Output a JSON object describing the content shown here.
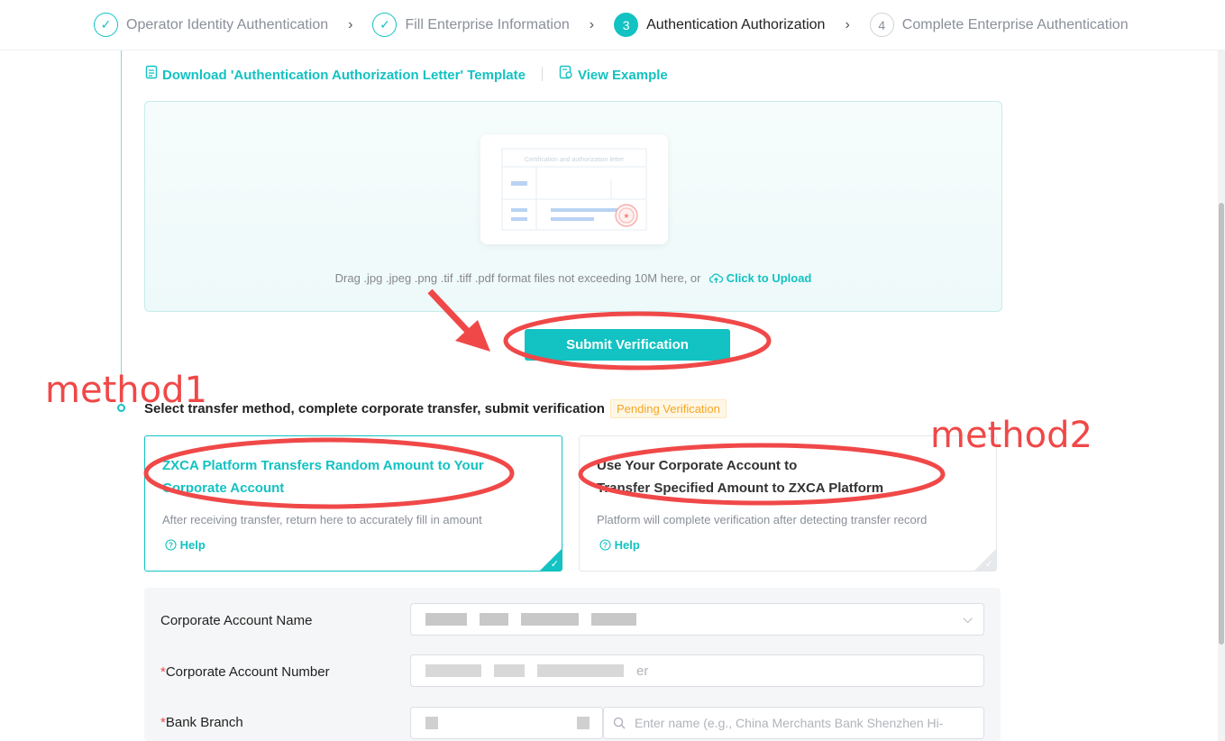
{
  "stepper": {
    "steps": [
      {
        "label": "Operator Identity Authentication",
        "status": "done"
      },
      {
        "label": "Fill Enterprise Information",
        "status": "done"
      },
      {
        "label": "Authentication Authorization",
        "status": "active",
        "number": "3"
      },
      {
        "label": "Complete Enterprise Authentication",
        "status": "todo",
        "number": "4"
      }
    ]
  },
  "links": {
    "download": "Download 'Authentication Authorization Letter' Template",
    "example": "View Example"
  },
  "upload": {
    "preview_title": "Certification and authorization letter",
    "hint": "Drag .jpg .jpeg .png .tif .tiff .pdf format files not exceeding 10M here, or",
    "upload_label": "Click to Upload"
  },
  "submit_label": "Submit Verification",
  "section": {
    "title": "Select transfer method, complete corporate transfer, submit verification",
    "badge": "Pending Verification"
  },
  "methods": [
    {
      "title_line1": "ZXCA Platform Transfers Random Amount to Your",
      "title_line2": "Corporate Account",
      "desc": "After receiving transfer, return here to accurately fill in amount",
      "help": "Help",
      "selected": true
    },
    {
      "title_line1": "Use Your Corporate Account to",
      "title_line2": "Transfer Specified Amount to ZXCA Platform",
      "desc": "Platform will complete verification after detecting transfer record",
      "help": "Help",
      "selected": false
    }
  ],
  "form": {
    "account_name_label": "Corporate Account Name",
    "account_number_label": "Corporate Account Number",
    "account_number_placeholder_tail": "er",
    "bank_branch_label": "Bank Branch",
    "bank_branch_placeholder": "Enter name (e.g., China Merchants Bank Shenzhen Hi-"
  },
  "annotations": {
    "method1": "method1",
    "method2": "method2",
    "color": "#f04848"
  },
  "colors": {
    "accent": "#13c2c2",
    "warning": "#f5a623",
    "required": "#f04848"
  }
}
